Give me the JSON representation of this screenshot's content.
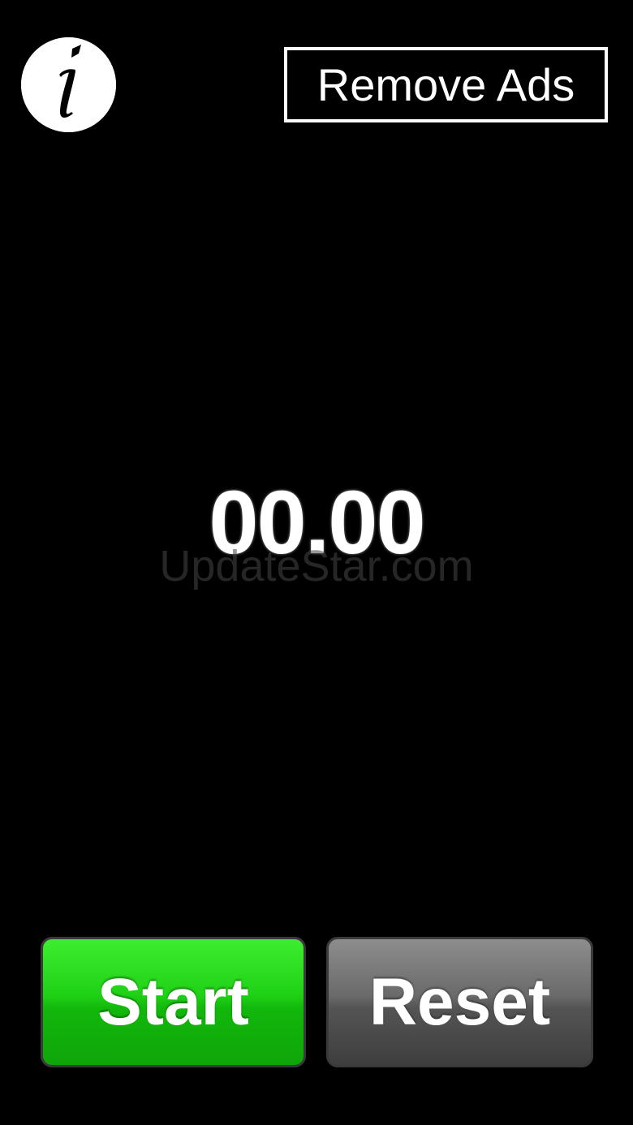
{
  "header": {
    "info_icon": "info-icon",
    "remove_ads_label": "Remove Ads"
  },
  "timer": {
    "display": "00.00"
  },
  "watermark": {
    "text": "UpdateStar.com"
  },
  "controls": {
    "start_label": "Start",
    "reset_label": "Reset"
  },
  "colors": {
    "background": "#000000",
    "start": "#1fd115",
    "reset": "#6a6a6a",
    "text": "#ffffff"
  }
}
